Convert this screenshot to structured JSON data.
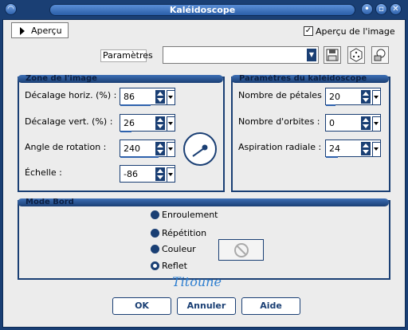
{
  "window": {
    "title": "Kaléidoscope"
  },
  "top": {
    "preview_button": "Aperçu",
    "preview_image_label": "Aperçu de l'image",
    "preview_image_checked": true,
    "params_label": "Paramètres",
    "params_value": ""
  },
  "zone": {
    "title": "Zone de l'image",
    "fields": [
      {
        "label": "Décalage horiz. (%) :",
        "value": "86"
      },
      {
        "label": "Décalage vert. (%) :",
        "value": "26"
      },
      {
        "label": "Angle de rotation :",
        "value": "240"
      },
      {
        "label": "Échelle :",
        "value": "-86"
      }
    ]
  },
  "kaleido": {
    "title": "Paramètres du kaléidoscope",
    "fields": [
      {
        "label": "Nombre de pétales :",
        "value": "20"
      },
      {
        "label": "Nombre d'orbites :",
        "value": "0"
      },
      {
        "label": "Aspiration radiale :",
        "value": "24"
      }
    ]
  },
  "mode": {
    "title": "Mode Bord",
    "options": [
      {
        "label": "Enroulement",
        "selected": false
      },
      {
        "label": "Répétition",
        "selected": false
      },
      {
        "label": "Couleur",
        "selected": false
      },
      {
        "label": "Reflet",
        "selected": true
      }
    ]
  },
  "signature": "Titoune",
  "buttons": {
    "ok": "OK",
    "cancel": "Annuler",
    "help": "Aide"
  },
  "colors": {
    "frame": "#1a3f74",
    "accent": "#2e62ad",
    "body": "#ececec"
  }
}
